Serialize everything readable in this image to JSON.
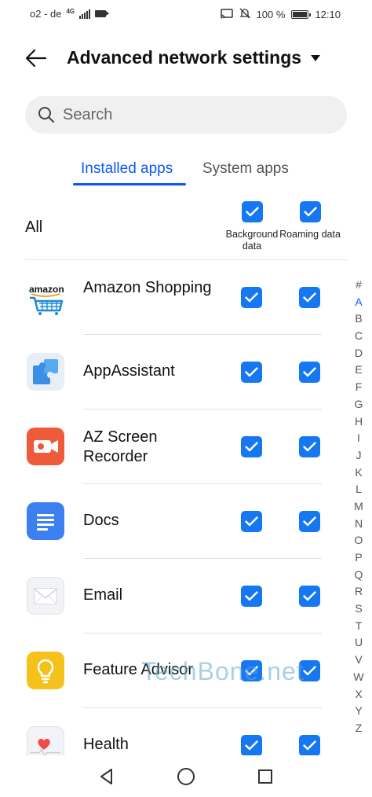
{
  "status_bar": {
    "carrier": "o2 - de",
    "network": "4G",
    "battery": "100 %",
    "time": "12:10"
  },
  "header": {
    "title": "Advanced network settings"
  },
  "search": {
    "placeholder": "Search"
  },
  "tabs": [
    {
      "label": "Installed apps",
      "active": true
    },
    {
      "label": "System apps",
      "active": false
    }
  ],
  "all_row": {
    "label": "All",
    "background_label": "Background data",
    "roaming_label": "Roaming data",
    "background_checked": true,
    "roaming_checked": true
  },
  "apps": [
    {
      "name": "Amazon Shopping",
      "icon": "amazon-icon",
      "background": true,
      "roaming": true
    },
    {
      "name": "AppAssistant",
      "icon": "puzzle-icon",
      "background": true,
      "roaming": true
    },
    {
      "name": "AZ Screen Recorder",
      "icon": "video-camera-icon",
      "background": true,
      "roaming": true
    },
    {
      "name": "Docs",
      "icon": "document-icon",
      "background": true,
      "roaming": true
    },
    {
      "name": "Email",
      "icon": "envelope-icon",
      "background": true,
      "roaming": true
    },
    {
      "name": "Feature Advisor",
      "icon": "lightbulb-icon",
      "background": true,
      "roaming": true
    },
    {
      "name": "Health",
      "icon": "heart-icon",
      "background": true,
      "roaming": true
    }
  ],
  "alpha_index": [
    "#",
    "A",
    "B",
    "C",
    "D",
    "E",
    "F",
    "G",
    "H",
    "I",
    "J",
    "K",
    "L",
    "M",
    "N",
    "O",
    "P",
    "Q",
    "R",
    "S",
    "T",
    "U",
    "V",
    "W",
    "X",
    "Y",
    "Z"
  ],
  "alpha_active": "A",
  "watermark": "TechBone.net",
  "colors": {
    "accent": "#0a59f7",
    "checkbox": "#1677f2"
  }
}
